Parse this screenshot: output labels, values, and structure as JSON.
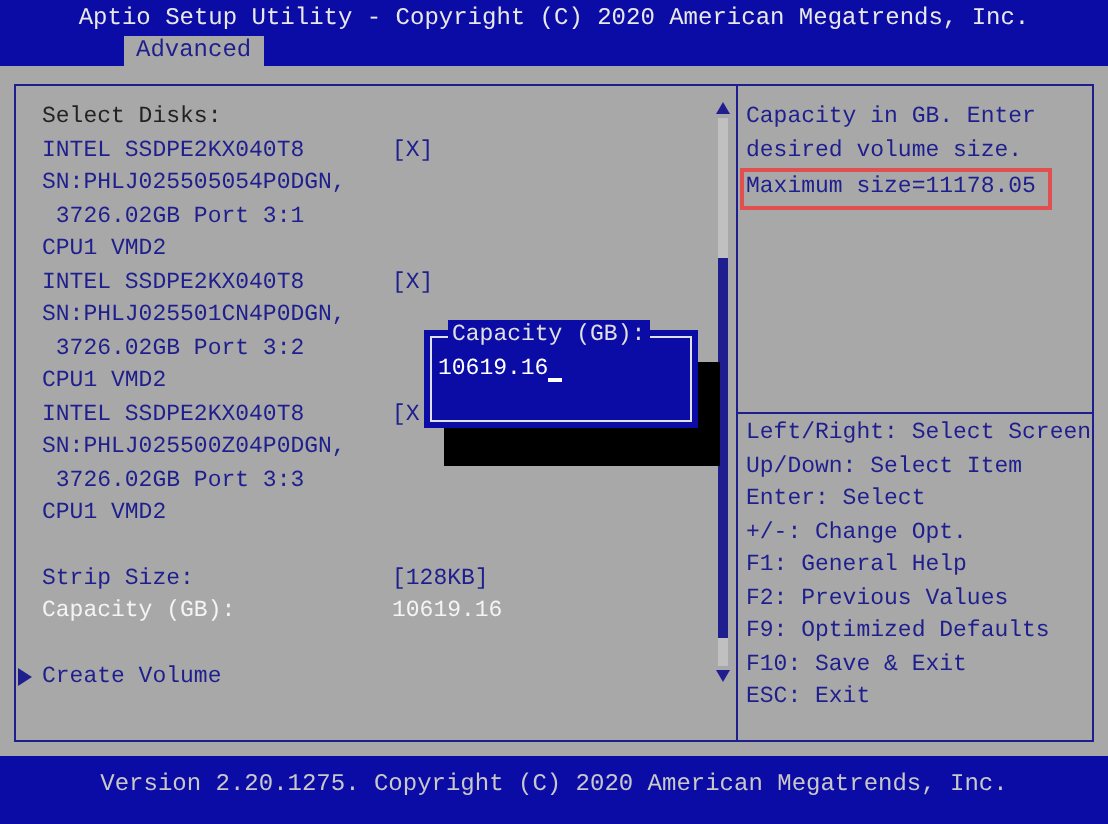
{
  "title": "Aptio Setup Utility - Copyright (C) 2020 American Megatrends, Inc.",
  "tabs": [
    {
      "label": "Advanced",
      "selected": true
    }
  ],
  "main": {
    "heading": "Select Disks:",
    "disks": [
      {
        "name": "INTEL SSDPE2KX040T8",
        "mark": "[X]",
        "checked": true,
        "lines": [
          "SN:PHLJ025505054P0DGN,",
          " 3726.02GB Port 3:1",
          "CPU1 VMD2"
        ]
      },
      {
        "name": "INTEL SSDPE2KX040T8",
        "mark": "[X]",
        "checked": true,
        "lines": [
          "SN:PHLJ025501CN4P0DGN,",
          " 3726.02GB Port 3:2",
          "CPU1 VMD2"
        ]
      },
      {
        "name": "INTEL SSDPE2KX040T8",
        "mark": "[X",
        "checked": true,
        "lines": [
          "SN:PHLJ025500Z04P0DGN,",
          " 3726.02GB Port 3:3",
          "CPU1 VMD2"
        ]
      }
    ],
    "settings": [
      {
        "label": "Strip Size:",
        "value": "[128KB]",
        "selected": false
      },
      {
        "label": "Capacity (GB):",
        "value": "10619.16",
        "selected": true
      }
    ],
    "actions": [
      {
        "label": "Create Volume",
        "selected": false
      }
    ]
  },
  "popup": {
    "title": "Capacity (GB):",
    "value": "10619.16"
  },
  "help": {
    "lines": [
      "Capacity in GB. Enter",
      "desired volume size."
    ],
    "highlight": "Maximum size=11178.05"
  },
  "keys": [
    "Left/Right: Select Screen",
    "Up/Down: Select Item",
    "Enter: Select",
    "+/-: Change Opt.",
    "F1: General Help",
    "F2: Previous Values",
    "F9: Optimized Defaults",
    "F10: Save & Exit",
    "ESC: Exit"
  ],
  "footer": "Version 2.20.1275. Copyright (C) 2020 American Megatrends, Inc."
}
